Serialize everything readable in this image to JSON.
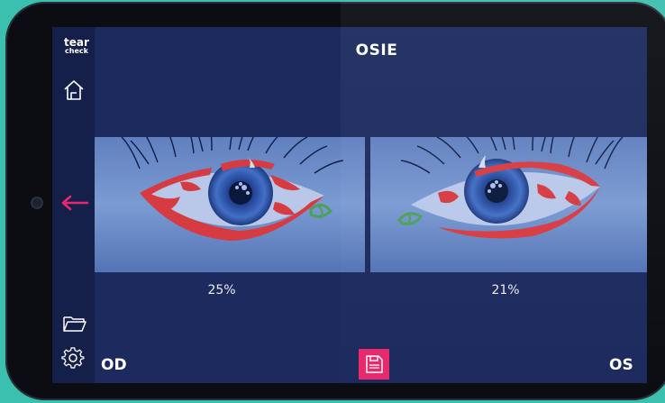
{
  "app": {
    "logo_line1": "tear",
    "logo_line2": "check",
    "title": "OSIE"
  },
  "sidebar": {
    "icons": [
      "home-icon",
      "back-arrow-icon",
      "folder-icon",
      "settings-gear-icon"
    ]
  },
  "eyes": [
    {
      "label": "OD",
      "percentage": "25%"
    },
    {
      "label": "OS",
      "percentage": "21%"
    }
  ],
  "toolbar": {
    "save_icon": "save-icon"
  },
  "colors": {
    "screen_bg": "#1c2a5e",
    "sidebar_bg": "#141f4a",
    "accent_pink": "#e8286b",
    "overlay_red": "#ff3b2f",
    "overlay_green": "#55b848"
  }
}
